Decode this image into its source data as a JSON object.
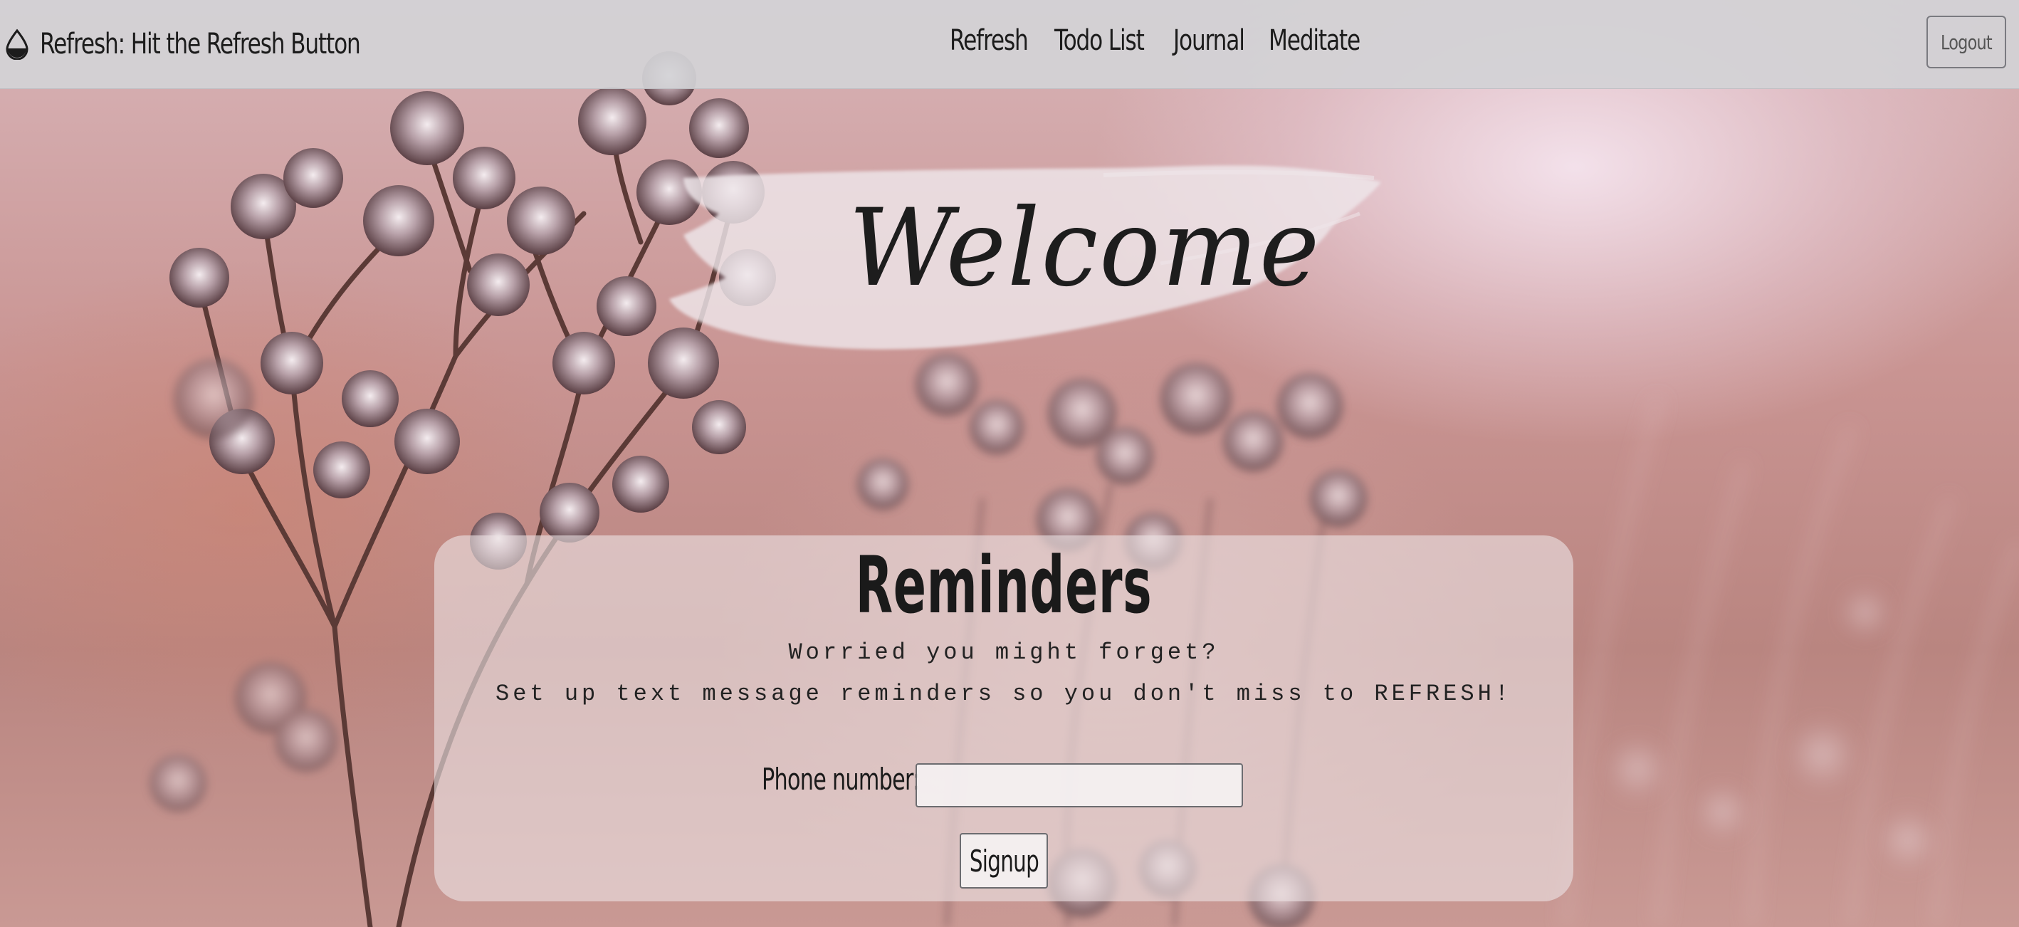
{
  "navbar": {
    "brand_icon": "water-drop-icon",
    "brand_title": "Refresh: Hit the Refresh Button",
    "links": [
      {
        "label": "Refresh"
      },
      {
        "label": "Todo List"
      },
      {
        "label": "Journal"
      },
      {
        "label": "Meditate"
      }
    ],
    "logout_label": "Logout"
  },
  "welcome": {
    "heading": "Welcome"
  },
  "reminders": {
    "title": "Reminders",
    "line1": "Worried you might forget?",
    "line2": "Set up text message reminders so you don't miss to REFRESH!",
    "phone_label": "Phone number:",
    "phone_value": "",
    "signup_label": "Signup"
  },
  "colors": {
    "navbar_bg": "#d2d2d6",
    "text": "#1c1c1c",
    "card_bg": "#ece2e4"
  }
}
